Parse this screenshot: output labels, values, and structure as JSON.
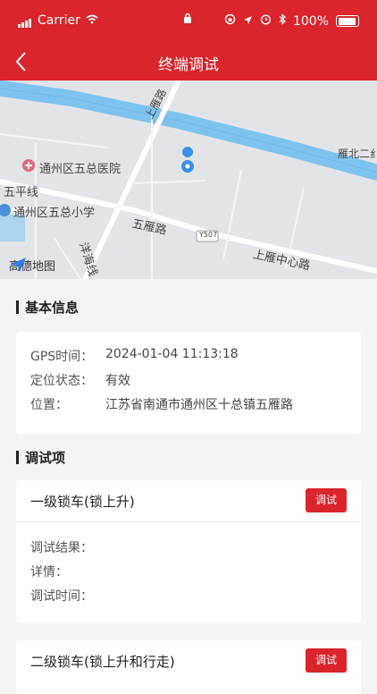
{
  "status": {
    "carrier": "Carrier",
    "battery": "100%"
  },
  "nav": {
    "title": "终端调试"
  },
  "map": {
    "labels": {
      "shangyan_road": "上雁路",
      "yanbei": "雁北二纟",
      "hospital": "通州区五总医院",
      "wuping": "五平线",
      "school": "通州区五总小学",
      "wuyan_road": "五雁路",
      "yanghai": "洋海线",
      "y507": "Y507",
      "shangyan_center": "上雁中心路",
      "gaode": "高德地图"
    }
  },
  "basic": {
    "title": "基本信息",
    "gps_key": "GPS时间：",
    "gps_val": "2024-01-04 11:13:18",
    "state_key": "定位状态：",
    "state_val": "有效",
    "pos_key": "位置：",
    "pos_val": "江苏省南通市通州区十总镇五雁路"
  },
  "debug": {
    "title": "调试项",
    "items": [
      {
        "name": "一级锁车(锁上升)",
        "button": "调试",
        "result": "调试结果：",
        "detail": "详情：",
        "time": "调试时间："
      },
      {
        "name": "二级锁车(锁上升和行走)",
        "button": "调试"
      }
    ]
  }
}
